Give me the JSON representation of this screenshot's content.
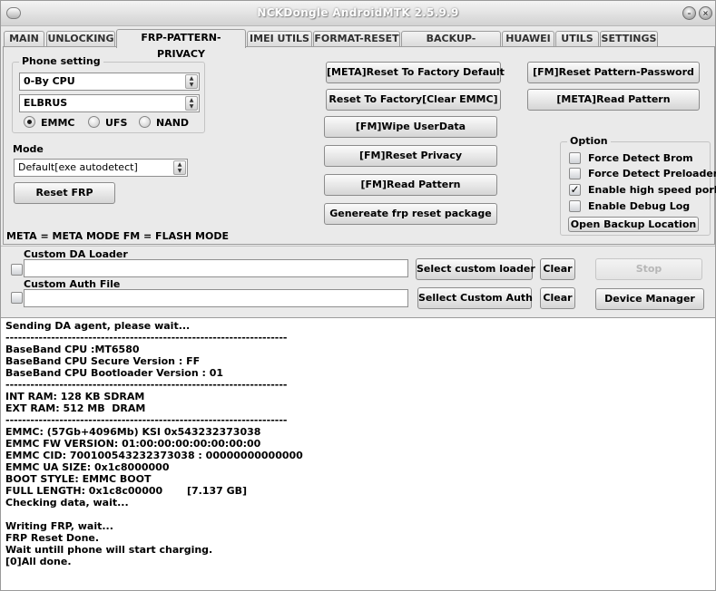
{
  "window": {
    "title": "NCKDongle AndroidMTK 2.5.9.9"
  },
  "tabs": [
    "MAIN",
    "UNLOCKING",
    "FRP-PATTERN-PRIVACY",
    "IMEI UTILS",
    "FORMAT-RESET",
    "BACKUP-RESTORE",
    "HUAWEI",
    "UTILS",
    "SETTINGS"
  ],
  "active_tab": "FRP-PATTERN-PRIVACY",
  "phone_setting": {
    "title": "Phone setting",
    "cpu_value": "0-By CPU",
    "model_value": "ELBRUS",
    "storage": {
      "emmc": "EMMC",
      "ufs": "UFS",
      "nand": "NAND",
      "selected": "EMMC"
    }
  },
  "mode": {
    "label": "Mode",
    "value": "Default[exe autodetect]"
  },
  "buttons": {
    "reset_frp": "Reset FRP",
    "meta_reset_factory": "[META]Reset To Factory Default",
    "reset_factory_clear_emmc": "Reset To Factory[Clear EMMC]",
    "fm_wipe_userdata": "[FM]Wipe UserData",
    "fm_reset_privacy": "[FM]Reset Privacy",
    "fm_read_pattern_center": "[FM]Read Pattern",
    "generate_frp_package": "Genereate frp reset package",
    "fm_reset_pattern_password": "[FM]Reset Pattern-Password",
    "meta_read_pattern": "[META]Read Pattern"
  },
  "option": {
    "title": "Option",
    "items": [
      {
        "label": "Force Detect Brom",
        "checked": false
      },
      {
        "label": "Force Detect Preloader",
        "checked": false
      },
      {
        "label": "Enable high speed porl",
        "checked": true
      },
      {
        "label": "Enable Debug Log",
        "checked": false
      }
    ],
    "open_backup": "Open Backup Location"
  },
  "legend_text": "META = META MODE     FM = FLASH MODE",
  "loader": {
    "da_label": "Custom DA Loader",
    "da_value": "",
    "auth_label": "Custom Auth File",
    "auth_value": "",
    "select_loader": "Select custom loader",
    "select_auth": "Sellect Custom Auth",
    "clear1": "Clear",
    "clear2": "Clear",
    "stop": "Stop",
    "device_manager": "Device Manager"
  },
  "log_lines": [
    "Sending DA agent, please wait...",
    "--------------------------------------------------------------------",
    "BaseBand CPU :MT6580",
    "BaseBand CPU Secure Version : FF",
    "BaseBand CPU Bootloader Version : 01",
    "--------------------------------------------------------------------",
    "INT RAM: 128 KB SDRAM",
    "EXT RAM: 512 MB  DRAM",
    "--------------------------------------------------------------------",
    "EMMC: (57Gb+4096Mb) KSI 0x543232373038",
    "EMMC FW VERSION: 01:00:00:00:00:00:00:00",
    "EMMC CID: 700100543232373038 : 00000000000000",
    "EMMC UA SIZE: 0x1c8000000",
    "BOOT STYLE: EMMC BOOT",
    "FULL LENGTH: 0x1c8c00000       [7.137 GB]",
    "Checking data, wait...",
    "",
    "Writing FRP, wait...",
    "FRP Reset Done.",
    "Wait untill phone will start charging.",
    "[0]All done."
  ]
}
